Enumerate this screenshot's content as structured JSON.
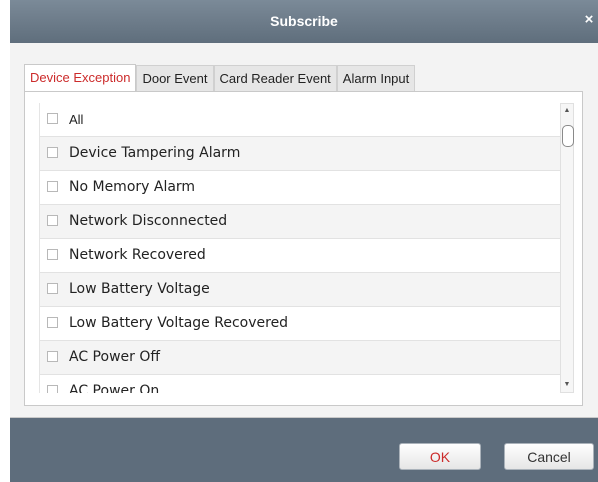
{
  "window": {
    "title": "Subscribe",
    "close_glyph": "×"
  },
  "tabs": [
    {
      "label": "Device Exception",
      "active": true
    },
    {
      "label": "Door Event",
      "active": false
    },
    {
      "label": "Card Reader Event",
      "active": false
    },
    {
      "label": "Alarm Input",
      "active": false
    }
  ],
  "list": {
    "items": [
      {
        "label": "All",
        "checked": false
      },
      {
        "label": "Device Tampering Alarm",
        "checked": false
      },
      {
        "label": "No Memory Alarm",
        "checked": false
      },
      {
        "label": "Network Disconnected",
        "checked": false
      },
      {
        "label": "Network Recovered",
        "checked": false
      },
      {
        "label": "Low Battery Voltage",
        "checked": false
      },
      {
        "label": "Low Battery Voltage Recovered",
        "checked": false
      },
      {
        "label": "AC Power Off",
        "checked": false
      },
      {
        "label": "AC Power On",
        "checked": false
      }
    ]
  },
  "scrollbar": {
    "up_glyph": "▲",
    "down_glyph": "▼"
  },
  "buttons": {
    "ok_label": "OK",
    "cancel_label": "Cancel"
  },
  "colors": {
    "accent": "#cc2b2b",
    "frame": "#5e6d7c",
    "content_bg": "#f3f3f3"
  }
}
